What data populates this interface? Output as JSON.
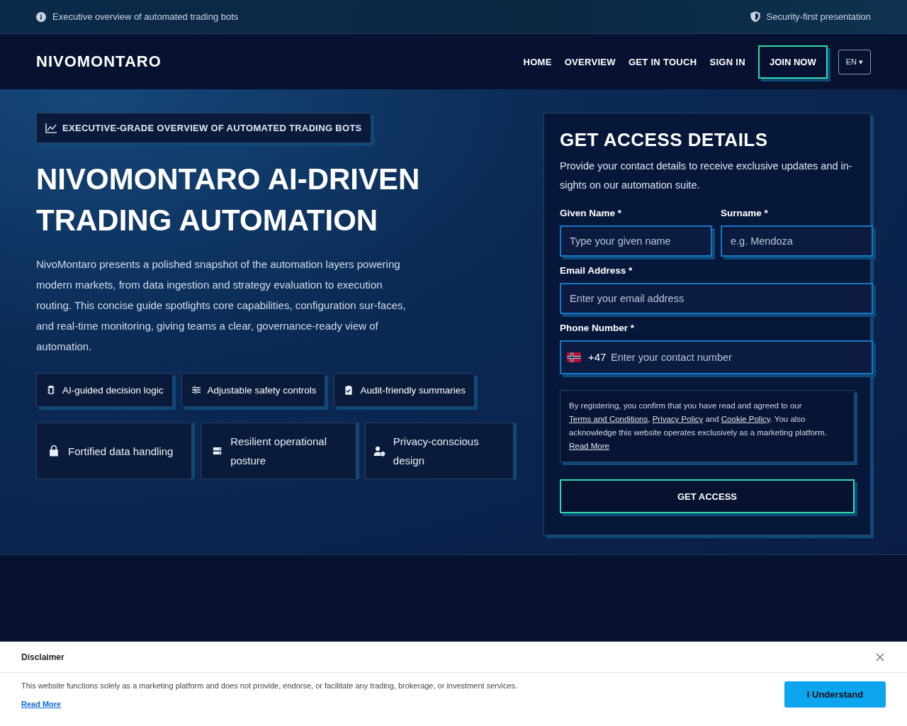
{
  "top_bar": {
    "left": "Executive overview of automated trading bots",
    "right": "Security-first presentation"
  },
  "nav": {
    "logo": "NIVOMONTARO",
    "links": [
      "HOME",
      "OVERVIEW",
      "GET IN TOUCH",
      "SIGN IN"
    ],
    "cta": "JOIN NOW",
    "language": "EN ▾"
  },
  "hero": {
    "eyebrow": "EXECUTIVE-GRADE OVERVIEW OF AUTOMATED TRADING BOTS",
    "title": "NIVOMONTARO AI-DRIVEN TRADING AUTOMATION",
    "intro": "NivoMontaro presents a polished snapshot of the automation layers powering modern markets, from data ingestion and strategy evaluation to execution routing. This concise guide spotlights core capabilities, configuration sur-faces, and real-time monitoring, giving teams a clear, governance-ready view of automation.",
    "chips": [
      "AI-guided decision logic",
      "Adjustable safety controls",
      "Audit-friendly summaries"
    ],
    "cards": [
      "Fortified data handling",
      "Resilient operational posture",
      "Privacy-conscious design"
    ]
  },
  "form": {
    "title": "GET ACCESS DETAILS",
    "subtitle": "Provide your contact details to receive exclusive updates and in-sights on our automation suite.",
    "fields": [
      {
        "label": "Given Name *",
        "placeholder": "Type your given name"
      },
      {
        "label": "Surname *",
        "placeholder": "e.g. Mendoza"
      },
      {
        "label": "Email Address *",
        "placeholder": "Enter your email address"
      },
      {
        "label": "Phone Number *",
        "placeholder": "Enter your contact number",
        "prefix": "+47"
      }
    ],
    "consent": [
      {
        "kind": "text",
        "text": "By registering, you confirm that you have read and agreed to our "
      },
      {
        "kind": "link",
        "text": "Terms and Conditions"
      },
      {
        "kind": "text",
        "text": ", "
      },
      {
        "kind": "link",
        "text": "Privacy Policy"
      },
      {
        "kind": "text",
        "text": " and "
      },
      {
        "kind": "link",
        "text": "Cookie Policy"
      },
      {
        "kind": "text",
        "text": ". You also acknowledge this website operates exclusively as a marketing platform. "
      },
      {
        "kind": "link",
        "text": "Read More"
      }
    ],
    "submit": "GET ACCESS"
  },
  "disclaimer": {
    "title": "Disclaimer",
    "text": "This website functions solely as a marketing platform and does not provide, endorse, or facilitate any trading, brokerage, or investment services.",
    "link": "Read More",
    "button": "I Understand"
  }
}
